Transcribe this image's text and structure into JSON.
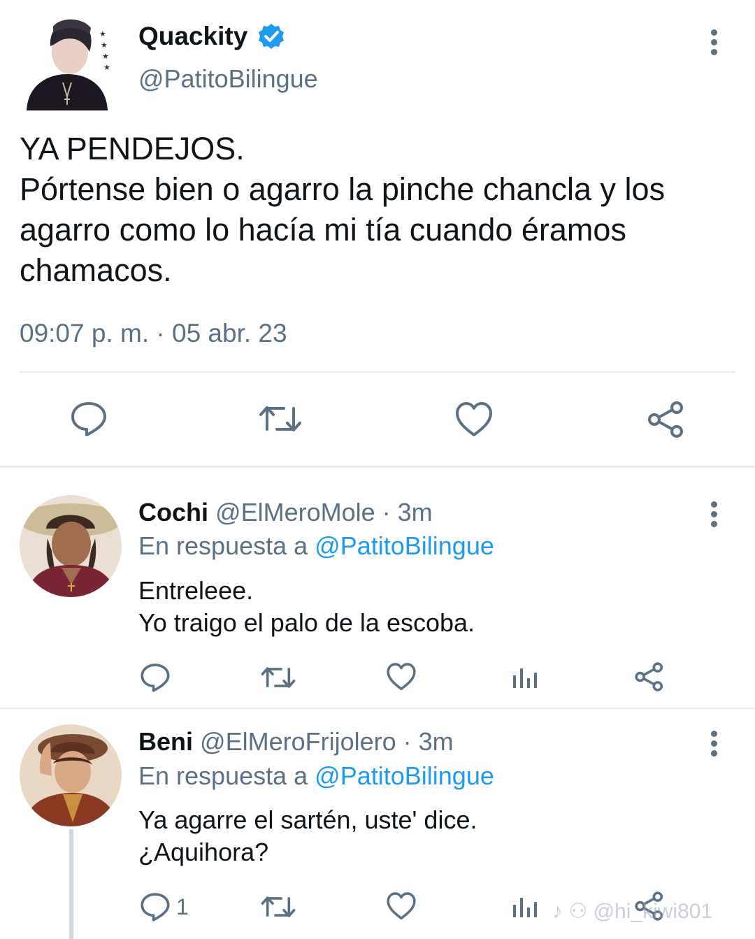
{
  "main_tweet": {
    "display_name": "Quackity",
    "handle": "@PatitoBilingue",
    "text_line1": "YA PENDEJOS.",
    "text_line2": "Pórtense bien o agarro la pinche chancla y los",
    "text_line3": "agarro como lo hacía mi tía cuando éramos",
    "text_line4": "chamacos.",
    "timestamp": "09:07 p. m. · 05 abr. 23",
    "icons": [
      "reply-icon",
      "retweet-icon",
      "like-icon",
      "share-icon"
    ]
  },
  "replies": [
    {
      "display_name": "Cochi",
      "handle": "@ElMeroMole",
      "time": "· 3m",
      "reply_prefix": "En respuesta a",
      "reply_to": "@PatitoBilingue",
      "text_line1": "Entreleee.",
      "text_line2": "Yo traigo el palo de la escoba.",
      "reply_count": ""
    },
    {
      "display_name": "Beni",
      "handle": "@ElMeroFrijolero",
      "time": "· 3m",
      "reply_prefix": "En respuesta a",
      "reply_to": "@PatitoBilingue",
      "text_line1": "Ya agarre el sartén, uste' dice.",
      "text_line2": "¿Aquihora?",
      "reply_count": "1"
    }
  ],
  "watermark": "@hi_kiwi801",
  "colors": {
    "accent": "#1d9bf0",
    "muted": "#5b7083",
    "divider": "#e6ecf0"
  }
}
